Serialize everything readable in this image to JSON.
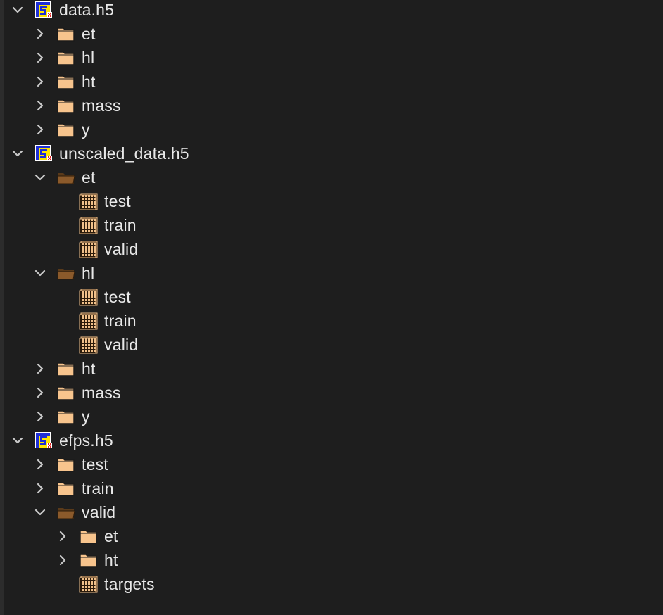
{
  "tree": [
    {
      "label": "data.h5",
      "type": "file",
      "depth": 0,
      "expanded": true
    },
    {
      "label": "et",
      "type": "group",
      "depth": 1,
      "expanded": false
    },
    {
      "label": "hl",
      "type": "group",
      "depth": 1,
      "expanded": false
    },
    {
      "label": "ht",
      "type": "group",
      "depth": 1,
      "expanded": false
    },
    {
      "label": "mass",
      "type": "group",
      "depth": 1,
      "expanded": false
    },
    {
      "label": "y",
      "type": "group",
      "depth": 1,
      "expanded": false
    },
    {
      "label": "unscaled_data.h5",
      "type": "file",
      "depth": 0,
      "expanded": true
    },
    {
      "label": "et",
      "type": "group",
      "depth": 1,
      "expanded": true
    },
    {
      "label": "test",
      "type": "dataset",
      "depth": 2
    },
    {
      "label": "train",
      "type": "dataset",
      "depth": 2
    },
    {
      "label": "valid",
      "type": "dataset",
      "depth": 2
    },
    {
      "label": "hl",
      "type": "group",
      "depth": 1,
      "expanded": true
    },
    {
      "label": "test",
      "type": "dataset",
      "depth": 2
    },
    {
      "label": "train",
      "type": "dataset",
      "depth": 2
    },
    {
      "label": "valid",
      "type": "dataset",
      "depth": 2
    },
    {
      "label": "ht",
      "type": "group",
      "depth": 1,
      "expanded": false
    },
    {
      "label": "mass",
      "type": "group",
      "depth": 1,
      "expanded": false
    },
    {
      "label": "y",
      "type": "group",
      "depth": 1,
      "expanded": false
    },
    {
      "label": "efps.h5",
      "type": "file",
      "depth": 0,
      "expanded": true
    },
    {
      "label": "test",
      "type": "group",
      "depth": 1,
      "expanded": false
    },
    {
      "label": "train",
      "type": "group",
      "depth": 1,
      "expanded": false
    },
    {
      "label": "valid",
      "type": "group",
      "depth": 1,
      "expanded": true
    },
    {
      "label": "et",
      "type": "group",
      "depth": 2,
      "expanded": false
    },
    {
      "label": "ht",
      "type": "group",
      "depth": 2,
      "expanded": false
    },
    {
      "label": "targets",
      "type": "dataset",
      "depth": 2
    }
  ],
  "icons": {
    "file": "hdf5-file-icon",
    "group": "folder-icon",
    "dataset": "dataset-grid-icon",
    "collapsed": "chevron-right-icon",
    "expanded": "chevron-down-icon"
  },
  "colors": {
    "background": "#1e1e1e",
    "text": "#e8e8e8",
    "chevron": "#c9c9c9",
    "folder_closed": "#f7c48d",
    "folder_open": "#8b5a2b",
    "hdf5_badge_blue": "#1e2fd6",
    "hdf5_badge_yellow": "#ffe600",
    "dataset_fill": "#f0c08a"
  }
}
